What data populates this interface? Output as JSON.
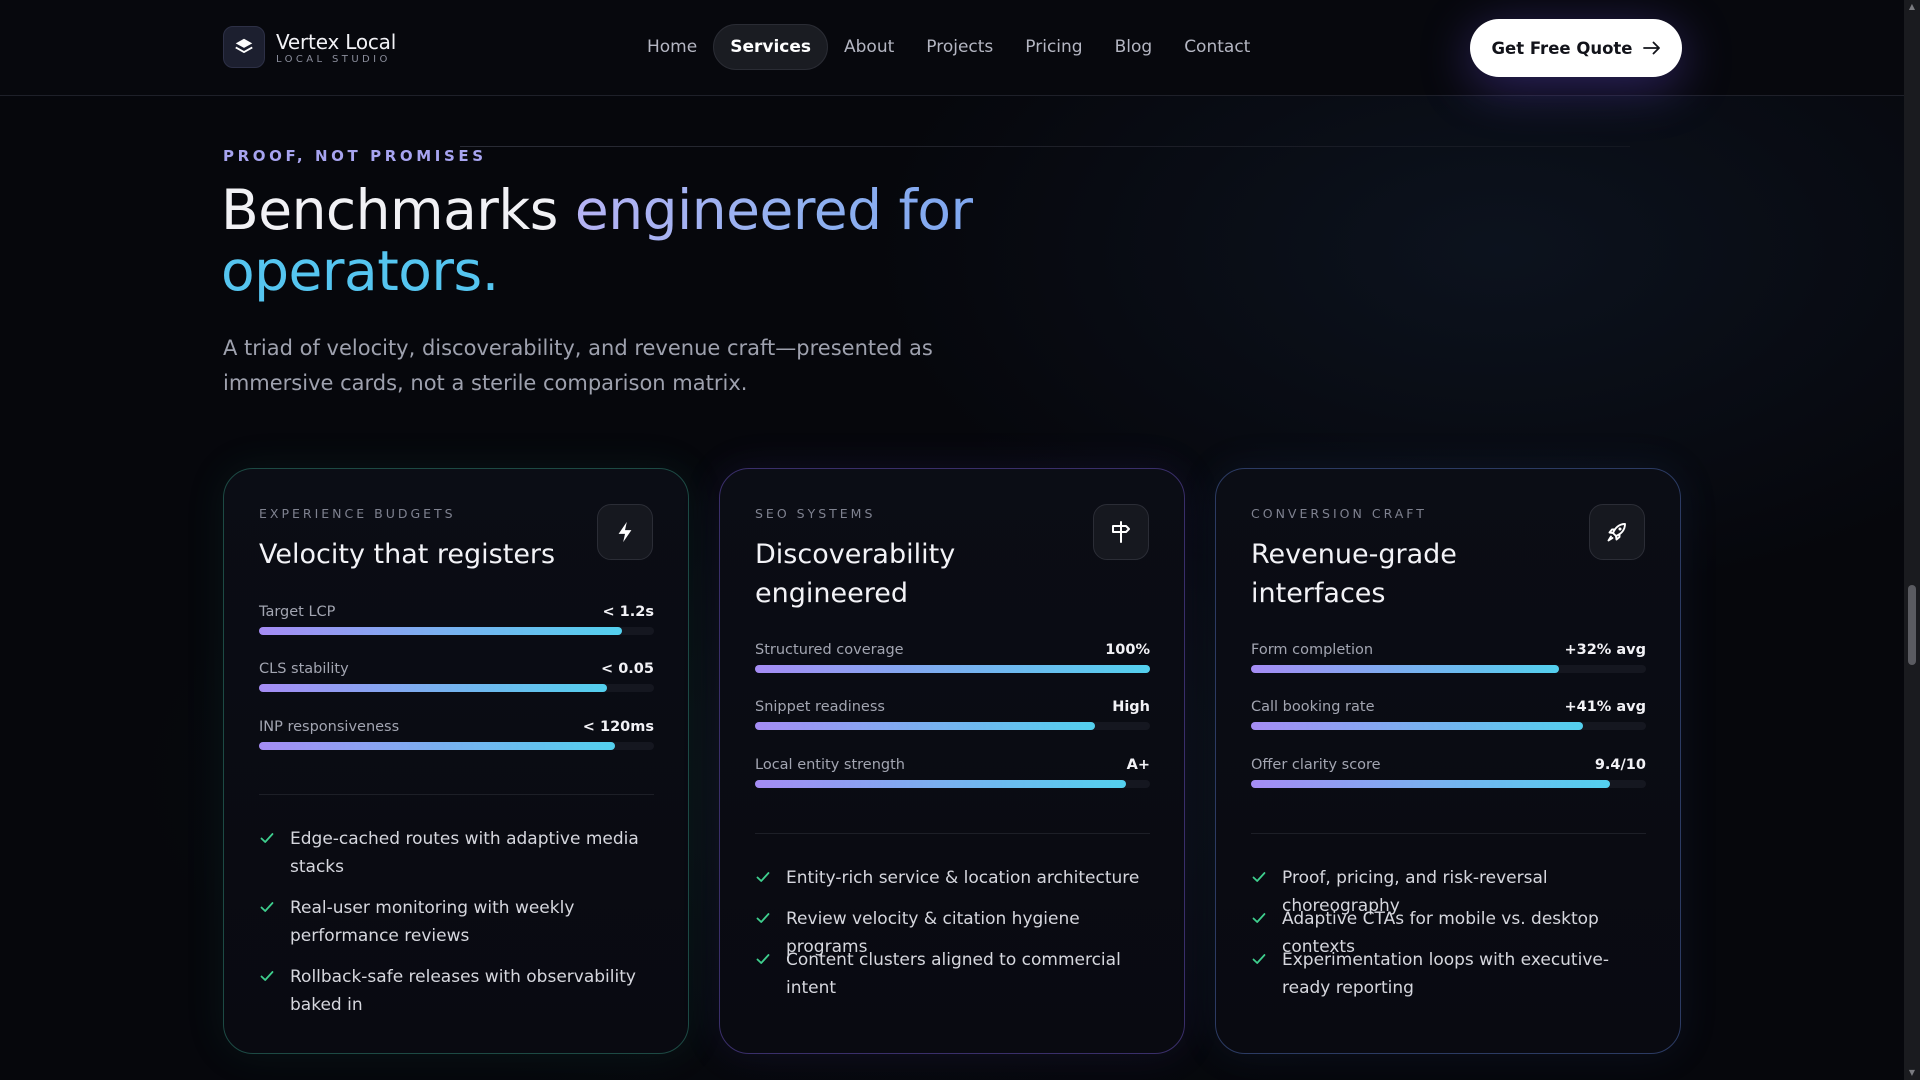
{
  "brand": {
    "name": "Vertex Local",
    "sub": "LOCAL STUDIO"
  },
  "nav": {
    "items": [
      {
        "label": "Home",
        "active": false
      },
      {
        "label": "Services",
        "active": true
      },
      {
        "label": "About",
        "active": false
      },
      {
        "label": "Projects",
        "active": false
      },
      {
        "label": "Pricing",
        "active": false
      },
      {
        "label": "Blog",
        "active": false
      },
      {
        "label": "Contact",
        "active": false
      }
    ],
    "cta": "Get Free Quote"
  },
  "hero": {
    "eyebrow": "PROOF, NOT PROMISES",
    "title_part1": "Benchmarks ",
    "title_part2": "engineered for",
    "title_part3": "operators.",
    "description": "A triad of velocity, discoverability, and revenue craft—presented as immersive cards, not a sterile comparison matrix."
  },
  "cards": [
    {
      "eyebrow": "EXPERIENCE BUDGETS",
      "title": "Velocity that registers",
      "icon": "lightning-icon",
      "metrics": [
        {
          "label": "Target LCP",
          "value": "< 1.2s",
          "level": 0.92
        },
        {
          "label": "CLS stability",
          "value": "< 0.05",
          "level": 0.88
        },
        {
          "label": "INP responsiveness",
          "value": "< 120ms",
          "level": 0.9
        }
      ],
      "bullets": [
        "Edge-cached routes with adaptive media stacks",
        "Real-user monitoring with weekly performance reviews",
        "Rollback-safe releases with observability baked in"
      ]
    },
    {
      "eyebrow": "SEO SYSTEMS",
      "title": "Discoverability engineered",
      "icon": "signpost-icon",
      "metrics": [
        {
          "label": "Structured coverage",
          "value": "100%",
          "level": 1.0
        },
        {
          "label": "Snippet readiness",
          "value": "High",
          "level": 0.86
        },
        {
          "label": "Local entity strength",
          "value": "A+",
          "level": 0.94
        }
      ],
      "bullets": [
        "Entity-rich service & location architecture",
        "Review velocity & citation hygiene programs",
        "Content clusters aligned to commercial intent"
      ]
    },
    {
      "eyebrow": "CONVERSION CRAFT",
      "title": "Revenue-grade interfaces",
      "icon": "rocket-icon",
      "metrics": [
        {
          "label": "Form completion",
          "value": "+32% avg",
          "level": 0.78
        },
        {
          "label": "Call booking rate",
          "value": "+41% avg",
          "level": 0.84
        },
        {
          "label": "Offer clarity score",
          "value": "9.4/10",
          "level": 0.91
        }
      ],
      "bullets": [
        "Proof, pricing, and risk-reversal choreography",
        "Adaptive CTAs for mobile vs. desktop contexts",
        "Experimentation loops with executive-ready reporting"
      ]
    }
  ],
  "colors": {
    "accent": "#a7a4f0",
    "cyan": "#53d0ee",
    "background": "#06070c"
  }
}
